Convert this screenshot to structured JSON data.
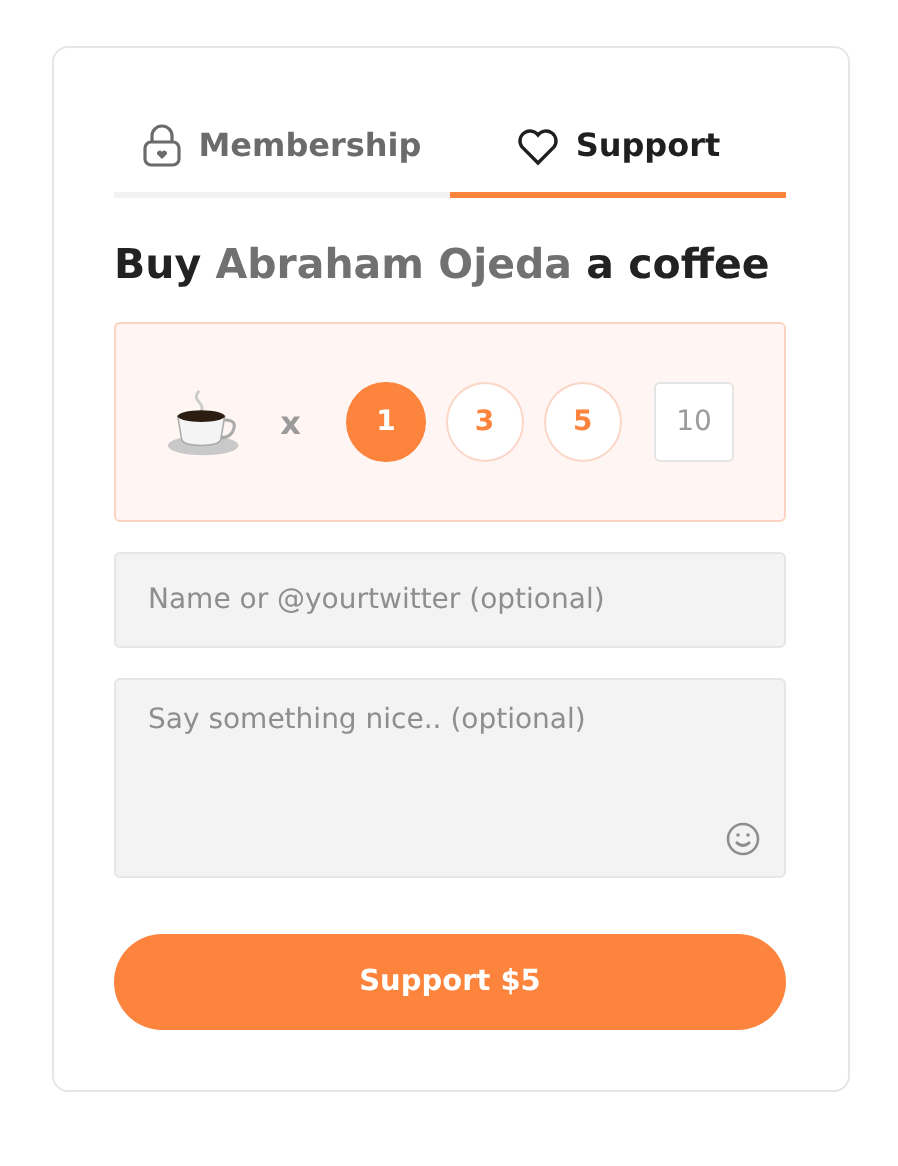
{
  "tabs": [
    {
      "label": "Membership",
      "kind": "lock",
      "selected": false
    },
    {
      "label": "Support",
      "kind": "heart",
      "selected": true
    }
  ],
  "heading": {
    "prefix": "Buy",
    "name": "Abraham Ojeda",
    "suffix": "a coffee"
  },
  "quantity": {
    "multiplier": "x",
    "options": [
      {
        "label": "1",
        "selected": true
      },
      {
        "label": "3",
        "selected": false
      },
      {
        "label": "5",
        "selected": false
      }
    ],
    "custom": {
      "placeholder": "10"
    }
  },
  "name_field": {
    "placeholder": "Name or @yourtwitter (optional)"
  },
  "message_field": {
    "placeholder": "Say something nice.. (optional)"
  },
  "submit": {
    "label": "Support $5"
  }
}
